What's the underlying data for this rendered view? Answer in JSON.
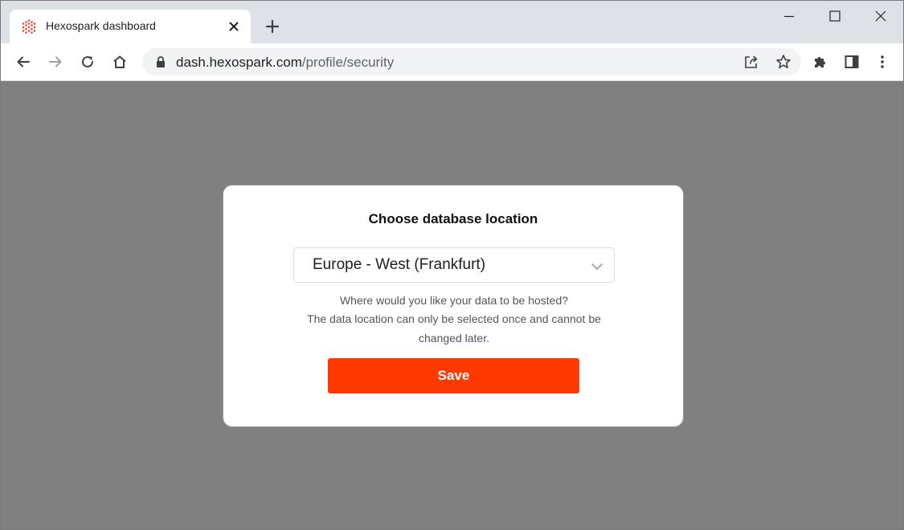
{
  "browser": {
    "tab": {
      "title": "Hexospark dashboard"
    },
    "address_bar": {
      "host": "dash.hexospark.com",
      "path": "/profile/security"
    }
  },
  "modal": {
    "title": "Choose database location",
    "select": {
      "selected": "Europe - West (Frankfurt)"
    },
    "helper_line_1": "Where would you like your data to be hosted?",
    "helper_line_2": "The data location can only be selected once and cannot be",
    "helper_line_3": "changed later.",
    "save_label": "Save"
  },
  "colors": {
    "accent": "#ff3a00",
    "favicon": "#e8432d",
    "overlay": "#808080"
  }
}
